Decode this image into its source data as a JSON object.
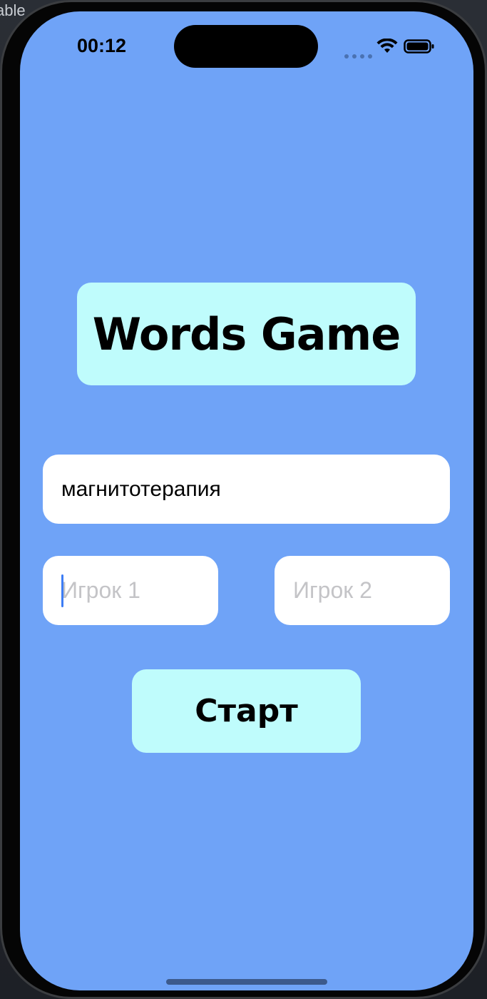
{
  "desktop": {
    "fragment_text": "able"
  },
  "status_bar": {
    "time": "00:12",
    "icons": [
      "signal-dots-icon",
      "wifi-icon",
      "battery-icon"
    ]
  },
  "app": {
    "title": "Words Game",
    "word_field": {
      "value": "магнитотерапия"
    },
    "player1_field": {
      "placeholder": "Игрок 1",
      "value": ""
    },
    "player2_field": {
      "placeholder": "Игрок 2",
      "value": ""
    },
    "start_label": "Старт"
  },
  "colors": {
    "background": "#6fa3f7",
    "accent": "#bffcfc",
    "field_background": "#ffffff",
    "placeholder": "#c4c4c7",
    "caret": "#3d7df5"
  }
}
